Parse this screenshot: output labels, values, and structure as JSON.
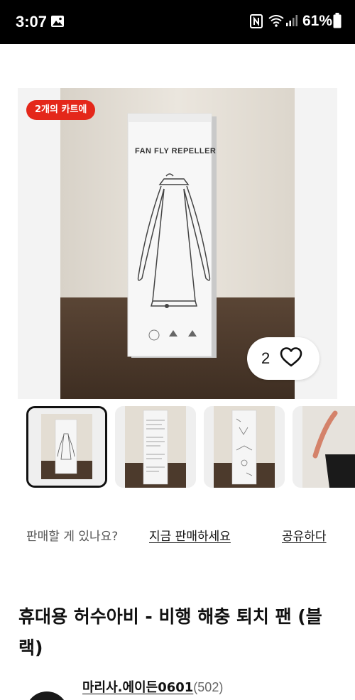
{
  "status_bar": {
    "time": "3:07",
    "battery": "61%",
    "icons": [
      "photo-icon",
      "nfc-icon",
      "wifi-icon",
      "signal-icon",
      "battery-icon"
    ]
  },
  "product_image": {
    "badge": "2개의 카트에",
    "box_text": "FAN  FLY REPELLER",
    "like_count": "2"
  },
  "thumbnails": [
    {
      "selected": true
    },
    {
      "selected": false
    },
    {
      "selected": false
    },
    {
      "selected": false
    }
  ],
  "sell_row": {
    "prompt": "판매할 게 있나요?",
    "sell_link": "지금 판매하세요",
    "share_link": "공유하다"
  },
  "product": {
    "title": "휴대용 허수아비 - 비행 해충 퇴치 팬 (블랙)"
  },
  "seller": {
    "name": "마리사.에이든0601",
    "review_count": "(502)"
  },
  "colors": {
    "badge": "#e4271a",
    "status_bar": "#000000",
    "text": "#111111"
  }
}
